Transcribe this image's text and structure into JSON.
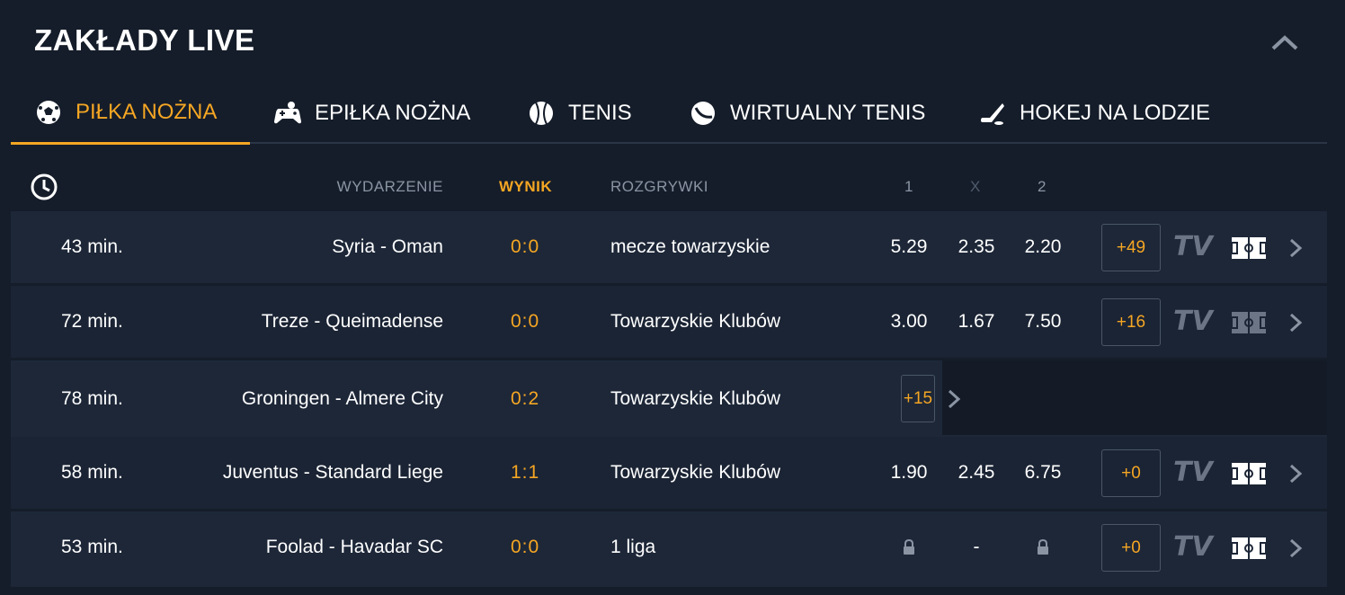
{
  "header": {
    "title": "ZAKŁADY LIVE"
  },
  "tabs": [
    {
      "label": "PIŁKA NOŻNA",
      "icon": "soccer-ball-icon",
      "active": true
    },
    {
      "label": "EPIŁKA NOŻNA",
      "icon": "gamepad-icon",
      "active": false
    },
    {
      "label": "TENIS",
      "icon": "tennis-ball-icon",
      "active": false
    },
    {
      "label": "WIRTUALNY TENIS",
      "icon": "virtual-tennis-icon",
      "active": false
    },
    {
      "label": "HOKEJ NA LODZIE",
      "icon": "hockey-stick-icon",
      "active": false
    }
  ],
  "columns": {
    "event": "WYDARZENIE",
    "score": "WYNIK",
    "league": "ROZGRYWKI",
    "one": "1",
    "x": "X",
    "two": "2"
  },
  "matches": [
    {
      "time": "43 min.",
      "event": "Syria - Oman",
      "score": "0:0",
      "league": "mecze towarzyskie",
      "o1": "5.29",
      "ox": "2.35",
      "o2": "2.20",
      "more": "+49",
      "tv": "TV"
    },
    {
      "time": "72 min.",
      "event": "Treze - Queimadense",
      "score": "0:0",
      "league": "Towarzyskie Klubów",
      "o1": "3.00",
      "ox": "1.67",
      "o2": "7.50",
      "more": "+16",
      "tv": "TV"
    },
    {
      "time": "78 min.",
      "event": "Groningen - Almere City",
      "score": "0:2",
      "league": "Towarzyskie Klubów",
      "more": "+15"
    },
    {
      "time": "58 min.",
      "event": "Juventus - Standard Liege",
      "score": "1:1",
      "league": "Towarzyskie Klubów",
      "o1": "1.90",
      "ox": "2.45",
      "o2": "6.75",
      "more": "+0",
      "tv": "TV"
    },
    {
      "time": "53 min.",
      "event": "Foolad - Havadar SC",
      "score": "0:0",
      "league": "1 liga",
      "ox": "-",
      "more": "+0",
      "tv": "TV"
    }
  ],
  "colors": {
    "accent": "#f5a623",
    "background": "#151d2a",
    "row": "#1d2738"
  }
}
